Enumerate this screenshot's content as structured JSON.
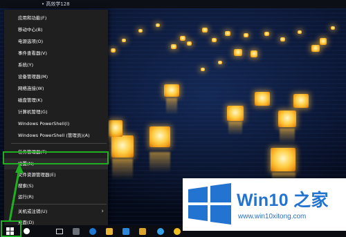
{
  "window": {
    "top_strip_text": "• 高效学128"
  },
  "start_menu": {
    "items": [
      {
        "label": "应用和功能(F)"
      },
      {
        "label": "移动中心(B)"
      },
      {
        "label": "电源选项(O)"
      },
      {
        "label": "事件查看器(V)"
      },
      {
        "label": "系统(Y)"
      },
      {
        "label": "设备管理器(M)"
      },
      {
        "label": "网络连接(W)"
      },
      {
        "label": "磁盘管理(K)"
      },
      {
        "label": "计算机管理(G)"
      },
      {
        "label": "Windows PowerShell(I)"
      },
      {
        "label": "Windows PowerShell (管理员)(A)"
      },
      {
        "label": "任务管理器(T)"
      },
      {
        "label": "设置(N)"
      },
      {
        "label": "文件资源管理器(E)"
      },
      {
        "label": "搜索(S)"
      },
      {
        "label": "运行(R)"
      },
      {
        "label": "关机或注销(U)"
      },
      {
        "label": "桌面(D)"
      }
    ],
    "submenu_arrow": "›",
    "selected": "设置(N)"
  },
  "taskbar": {
    "icons": [
      "windows-start-icon",
      "cortana-icon",
      "task-view-icon",
      "settings-icon",
      "edge-icon",
      "file-explorer-icon",
      "store-icon",
      "ie-icon",
      "media-icon",
      "app-icon"
    ]
  },
  "brand": {
    "title_prefix": "Win10",
    "title_suffix": " 之家",
    "url": "www.win10xitong.com",
    "color": "#2374d1"
  }
}
